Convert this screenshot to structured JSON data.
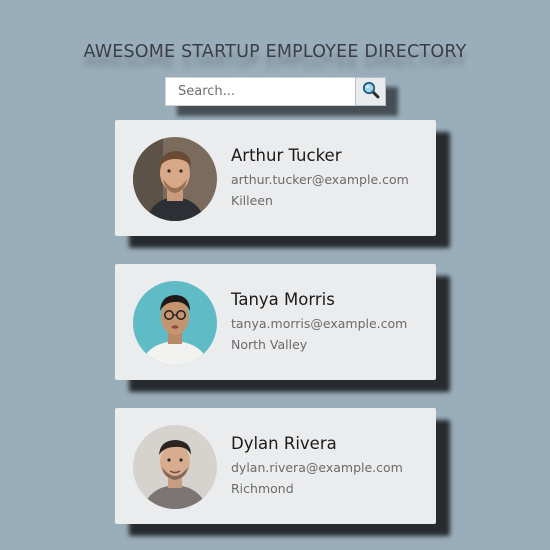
{
  "header": {
    "title": "AWESOME STARTUP EMPLOYEE DIRECTORY"
  },
  "search": {
    "placeholder": "Search...",
    "value": "",
    "button_icon": "search-icon"
  },
  "employees": [
    {
      "name": "Arthur Tucker",
      "email": "arthur.tucker@example.com",
      "city": "Killeen"
    },
    {
      "name": "Tanya Morris",
      "email": "tanya.morris@example.com",
      "city": "North Valley"
    },
    {
      "name": "Dylan Rivera",
      "email": "dylan.rivera@example.com",
      "city": "Richmond"
    }
  ]
}
